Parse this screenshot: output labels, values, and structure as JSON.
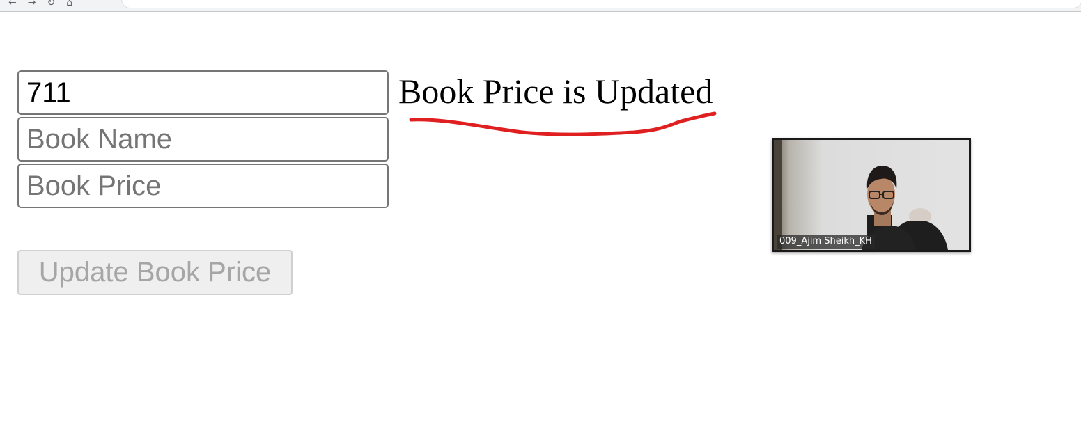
{
  "form": {
    "id_value": "711",
    "book_name_placeholder": "Book Name",
    "book_price_placeholder": "Book Price",
    "submit_label": "Update Book Price"
  },
  "status": {
    "message": "Book Price is Updated",
    "annotation_color": "#e02020"
  },
  "video": {
    "participant_name": "009_Ajim Sheikh_KH"
  }
}
